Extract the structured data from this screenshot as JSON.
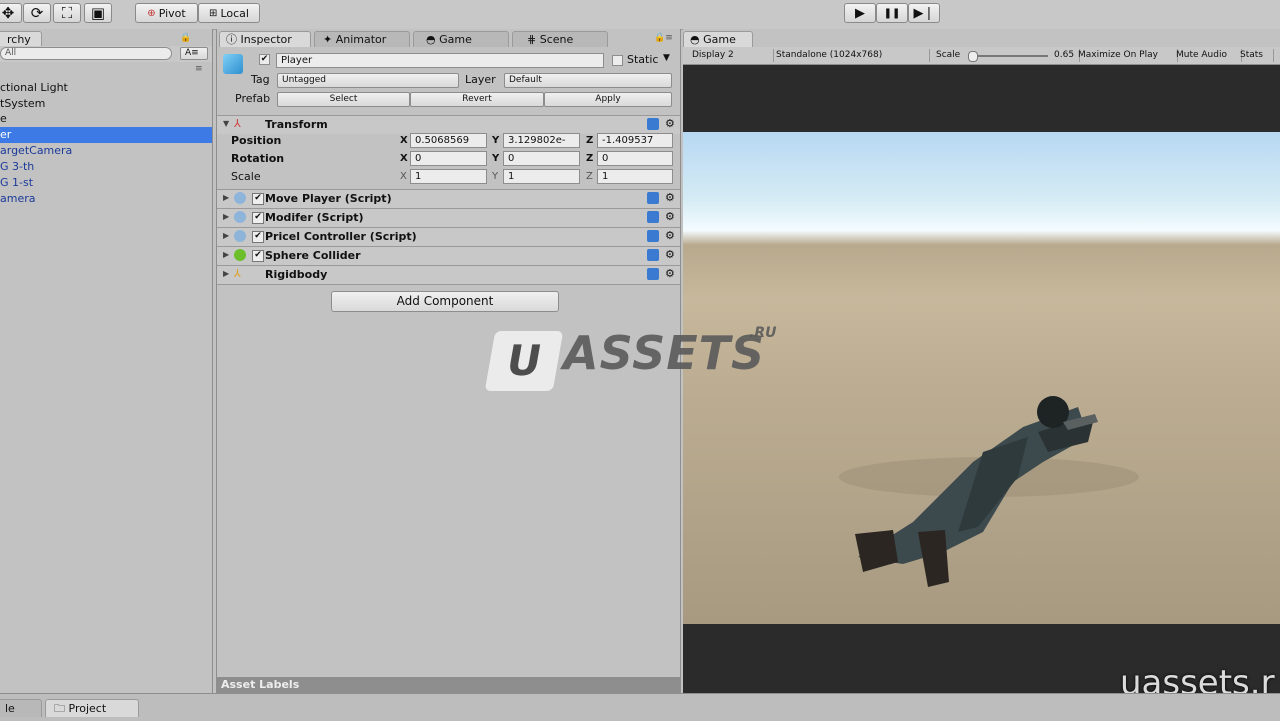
{
  "toolbar": {
    "tools": [
      "✥",
      "⟳",
      "⛶",
      "▣"
    ],
    "pivot": "Pivot",
    "local": "Local",
    "play": [
      "▶",
      "❚❚",
      "▶❘"
    ]
  },
  "hierarchy": {
    "tab": "rchy",
    "search": "All",
    "create": "A≡",
    "items": [
      "ctional Light",
      "tSystem",
      "e",
      "er",
      "argetCamera",
      "G 3-th",
      "G 1-st",
      "amera"
    ]
  },
  "inspector": {
    "tabs": [
      "Inspector",
      "Animator",
      "Game",
      "Scene"
    ],
    "object_name": "Player",
    "static_label": "Static",
    "tag_label": "Tag",
    "tag_value": "Untagged",
    "layer_label": "Layer",
    "layer_value": "Default",
    "prefab_label": "Prefab",
    "prefab_buttons": [
      "Select",
      "Revert",
      "Apply"
    ],
    "transform": {
      "title": "Transform",
      "position_label": "Position",
      "rotation_label": "Rotation",
      "scale_label": "Scale",
      "axes": [
        "X",
        "Y",
        "Z"
      ],
      "position": [
        "0.5068569",
        "3.129802e-",
        "-1.409537"
      ],
      "rotation": [
        "0",
        "0",
        "0"
      ],
      "scale": [
        "1",
        "1",
        "1"
      ]
    },
    "components": [
      {
        "name": "Move Player (Script)",
        "color": "#8fb4d9"
      },
      {
        "name": "Modifer (Script)",
        "color": "#8fb4d9"
      },
      {
        "name": "Pricel Controller (Script)",
        "color": "#8fb4d9"
      },
      {
        "name": "Sphere Collider",
        "color": "#6cbf2a"
      },
      {
        "name": "Rigidbody",
        "color": "#e0a020"
      }
    ],
    "add_component": "Add Component",
    "asset_labels": "Asset Labels"
  },
  "game": {
    "tab": "Game",
    "display": "Display 2",
    "resolution": "Standalone (1024x768)",
    "scale_label": "Scale",
    "scale_value": "0.65",
    "maximize": "Maximize On Play",
    "mute": "Mute Audio",
    "stats": "Stats"
  },
  "watermark": {
    "logo_u": "U",
    "logo_text": "ASSETS",
    "logo_ru": ".RU",
    "corner": "uassets.r"
  },
  "bottom": {
    "tab_left": "le",
    "tab_project": "Project"
  }
}
